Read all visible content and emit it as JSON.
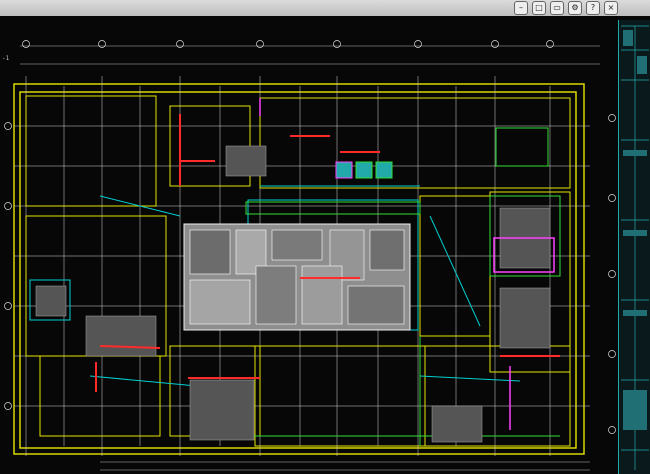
{
  "window": {
    "title": "",
    "buttons": [
      "minimize",
      "maximize",
      "close"
    ]
  },
  "drawing": {
    "background": "#070707",
    "grid_columns": 14,
    "grid_rows": 9,
    "axis_marker": "-1",
    "colors": {
      "walls": "#e6e600",
      "structure": "#ffffff",
      "dims": "#00d0d0",
      "highlight": "#ff2a2a",
      "accent": "#ff40ff",
      "green": "#33dd33",
      "panel_border": "#22aaaa"
    }
  },
  "icons": [
    "minimize-icon",
    "maximize-icon",
    "close-icon"
  ]
}
